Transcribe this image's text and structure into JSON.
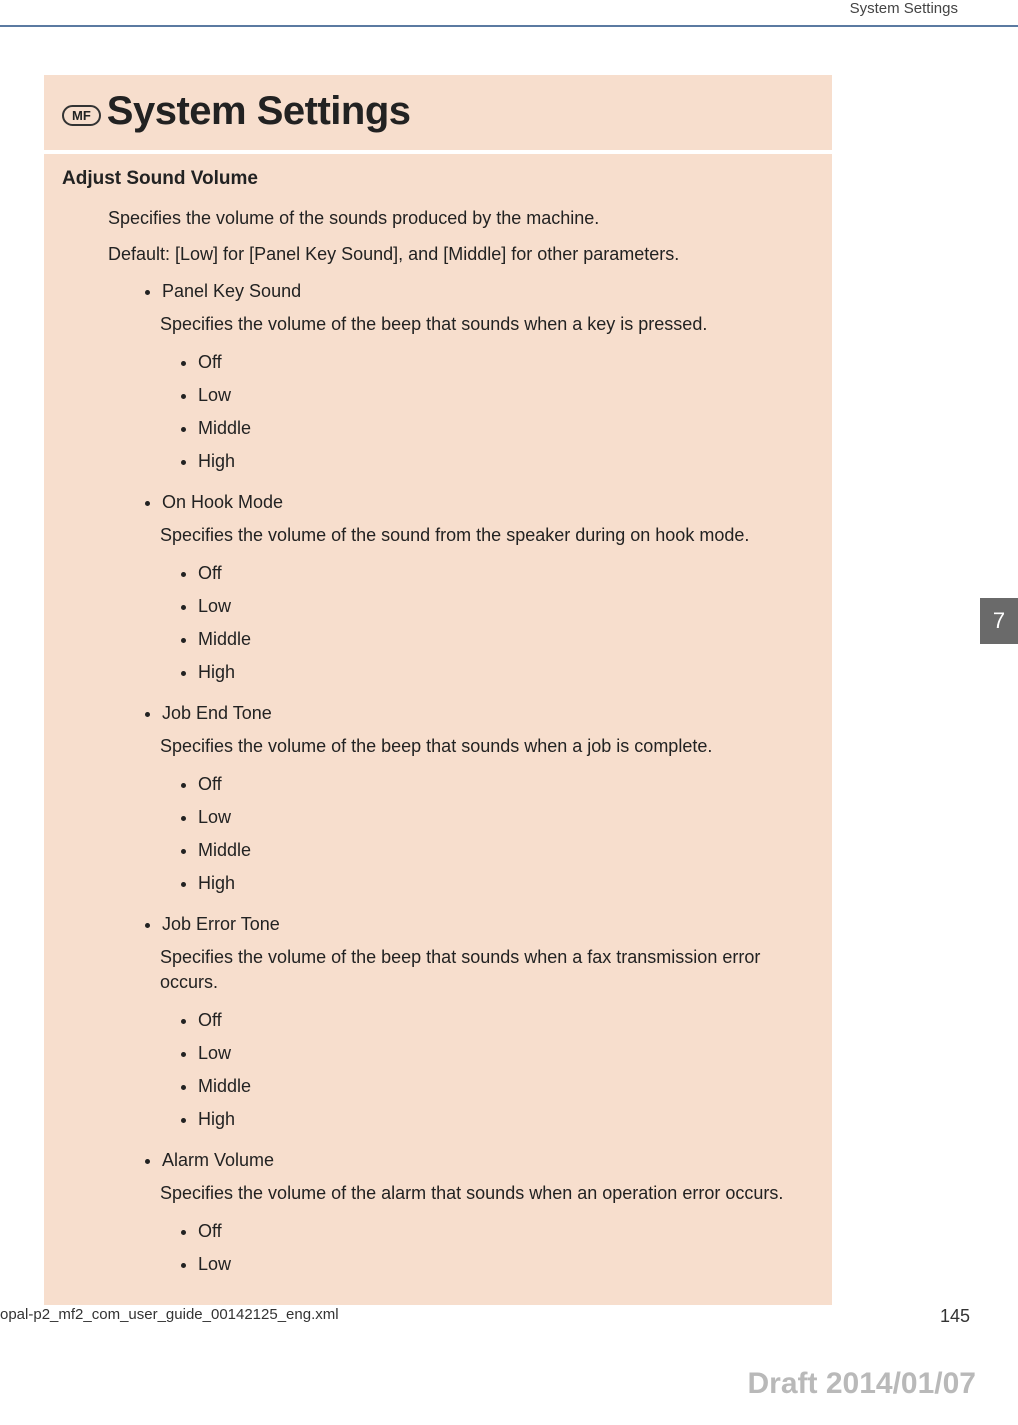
{
  "header": {
    "running_title": "System Settings"
  },
  "title": {
    "badge": "MF",
    "text": "System Settings"
  },
  "section": {
    "heading": "Adjust Sound Volume",
    "intro1": "Specifies the volume of the sounds produced by the machine.",
    "intro2": "Default: [Low] for [Panel Key Sound], and [Middle] for other parameters.",
    "items": [
      {
        "name": "Panel Key Sound",
        "desc": "Specifies the volume of the beep that sounds when a key is pressed.",
        "options": [
          "Off",
          "Low",
          "Middle",
          "High"
        ]
      },
      {
        "name": "On Hook Mode",
        "desc": "Specifies the volume of the sound from the speaker during on hook mode.",
        "options": [
          "Off",
          "Low",
          "Middle",
          "High"
        ]
      },
      {
        "name": "Job End Tone",
        "desc": "Specifies the volume of the beep that sounds when a job is complete.",
        "options": [
          "Off",
          "Low",
          "Middle",
          "High"
        ]
      },
      {
        "name": "Job Error Tone",
        "desc": "Specifies the volume of the beep that sounds when a fax transmission error occurs.",
        "options": [
          "Off",
          "Low",
          "Middle",
          "High"
        ]
      },
      {
        "name": "Alarm Volume",
        "desc": "Specifies the volume of the alarm that sounds when an operation error occurs.",
        "options": [
          "Off",
          "Low"
        ]
      }
    ]
  },
  "chapter_tab": "7",
  "footer": {
    "file": "opal-p2_mf2_com_user_guide_00142125_eng.xml",
    "page": "145"
  },
  "draft": "Draft 2014/01/07"
}
